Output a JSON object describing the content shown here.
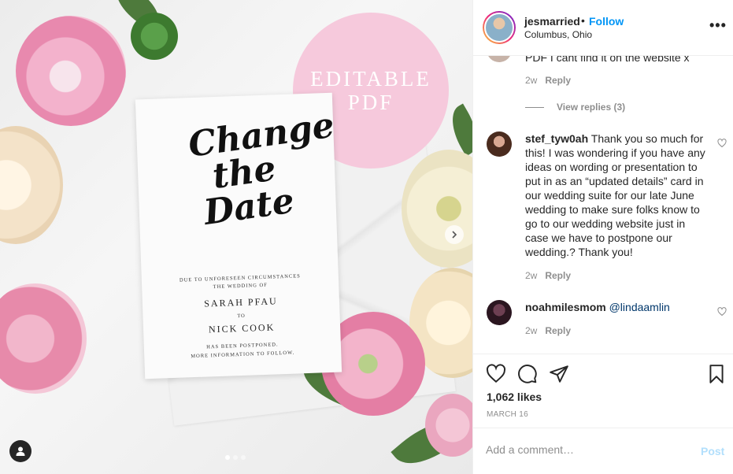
{
  "photo": {
    "badge_line1": "EDITABLE",
    "badge_line2": "PDF",
    "card": {
      "script_title": "Change the Date",
      "line1": "DUE TO UNFORESEEN CIRCUMSTANCES",
      "line2": "THE WEDDING OF",
      "name1": "SARAH PFAU",
      "to": "TO",
      "name2": "NICK COOK",
      "line3": "HAS BEEN POSTPONED.",
      "line4": "MORE INFORMATION TO FOLLOW."
    }
  },
  "header": {
    "username": "jesmarried",
    "separator": "•",
    "follow_label": "Follow",
    "location": "Columbus, Ohio",
    "more_label": "•••"
  },
  "comments": {
    "partial": {
      "text": "PDF I cant find it on the website x",
      "time": "2w",
      "reply_label": "Reply"
    },
    "view_replies_label": "View replies (3)",
    "items": [
      {
        "username": "stef_tyw0ah",
        "text": "Thank you so much for this! I was wondering if you have any ideas on wording or presentation to put in as an “updated details” card in our wedding suite for our late June wedding to make sure folks know to go to our wedding website just in case we have to postpone our wedding.? Thank you!",
        "time": "2w",
        "reply_label": "Reply"
      },
      {
        "username": "noahmilesmom",
        "mention": "@lindaamlin",
        "time": "2w",
        "reply_label": "Reply"
      }
    ]
  },
  "actions": {
    "icons": [
      "heart-icon",
      "comment-icon",
      "share-icon",
      "bookmark-icon"
    ],
    "likes": "1,062 likes",
    "date": "MARCH 16"
  },
  "add_comment": {
    "placeholder": "Add a comment…",
    "post_label": "Post"
  },
  "colors": {
    "follow": "#0095f6",
    "post_disabled": "#b2dffc",
    "muted": "#8e8e8e",
    "badge_pink": "#f6c9dc"
  }
}
